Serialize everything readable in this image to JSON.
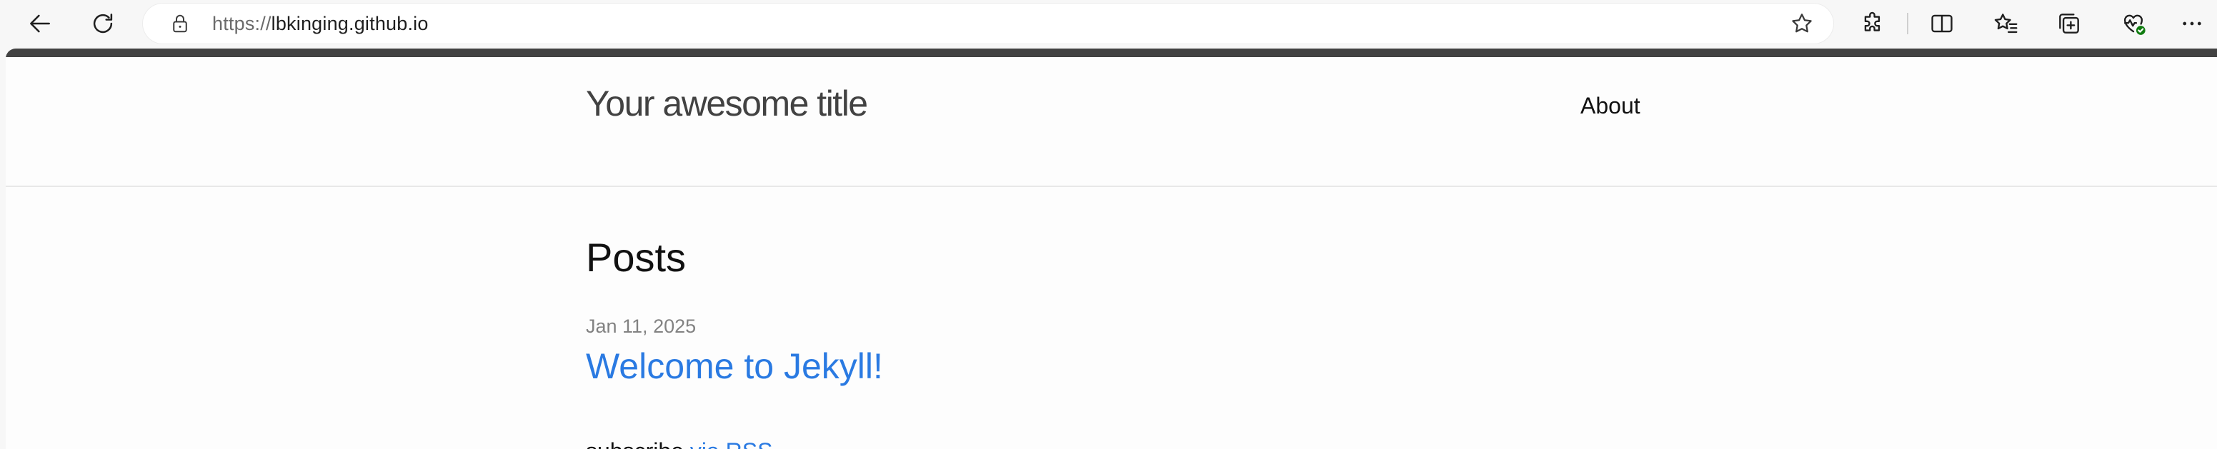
{
  "browser": {
    "url_protocol": "https://",
    "url_host": "lbkinging.github.io",
    "icons": {
      "back": "back-arrow-icon",
      "reload": "reload-icon",
      "lock": "lock-icon",
      "favorite": "star-icon",
      "extensions": "puzzle-icon",
      "split": "split-screen-icon",
      "favorites": "favorites-icon",
      "collections": "collections-icon",
      "health": "browser-essentials-icon",
      "more": "more-icon"
    }
  },
  "site": {
    "title": "Your awesome title",
    "nav": {
      "about": "About"
    }
  },
  "main": {
    "heading": "Posts",
    "posts": [
      {
        "date": "Jan 11, 2025",
        "title": "Welcome to Jekyll!"
      }
    ],
    "rss": {
      "prefix": "subscribe",
      "link": "via RSS"
    }
  },
  "colors": {
    "link": "#2a7ae2",
    "text": "#111111",
    "meta": "#828282",
    "header_strip": "#424242"
  }
}
